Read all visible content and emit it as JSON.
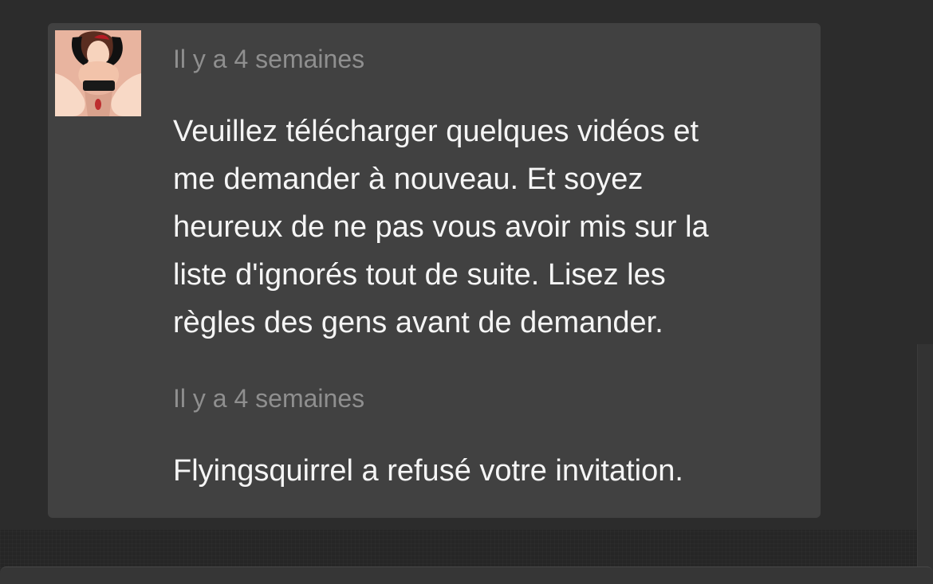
{
  "conversation": {
    "messages": [
      {
        "timestamp": "Il y a 4 semaines",
        "lines": [
          "Veuillez télécharger quelques vidéos et",
          "me demander à nouveau. Et soyez",
          "heureux de ne pas vous avoir mis sur la",
          "liste d'ignorés tout de suite. Lisez les",
          "règles des gens avant de demander."
        ]
      },
      {
        "timestamp": "Il y a 4 semaines",
        "text": "Flyingsquirrel a refusé votre invitation."
      }
    ]
  },
  "colors": {
    "page_background": "#262626",
    "card_background": "#414141",
    "timestamp_text": "#8f8f8f",
    "message_text": "#f5f5f5",
    "avatar_background": "#e8b49f"
  },
  "icons": {
    "avatar": "user-avatar"
  }
}
